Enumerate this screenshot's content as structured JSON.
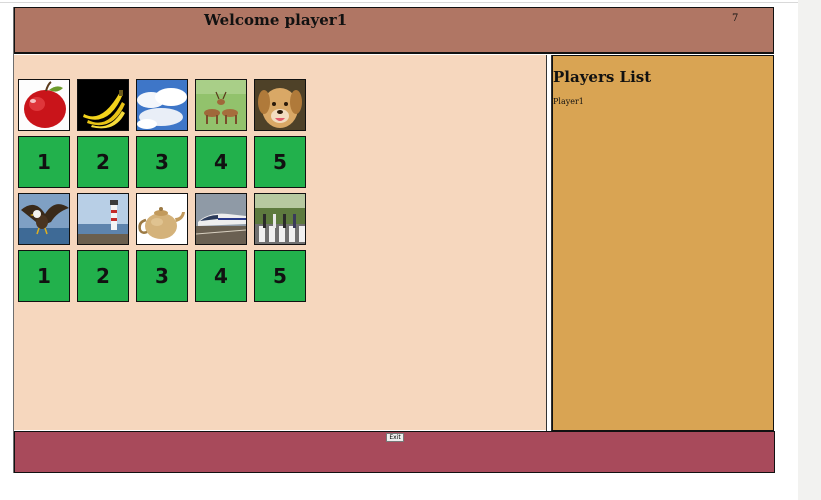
{
  "header": {
    "welcome": "Welcome player1",
    "counter": "7"
  },
  "sidebar": {
    "title": "Players List",
    "players": [
      "Player1"
    ]
  },
  "rows": [
    {
      "images": [
        "apple",
        "bananas",
        "sky-clouds",
        "deer",
        "dog"
      ],
      "numbers": [
        "1",
        "2",
        "3",
        "4",
        "5"
      ]
    },
    {
      "images": [
        "eagle",
        "lighthouse",
        "teapot",
        "train",
        "crosswalk"
      ],
      "numbers": [
        "1",
        "2",
        "3",
        "4",
        "5"
      ]
    }
  ],
  "footer": {
    "exit_label": "Exit"
  },
  "colors": {
    "header": "#b07664",
    "main": "#f6d7be",
    "sidebar": "#d9a453",
    "footer": "#a84a5b",
    "number_tile": "#22b14c"
  }
}
